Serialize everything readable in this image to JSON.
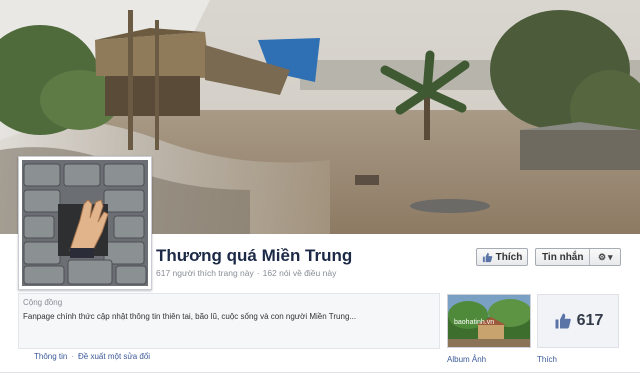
{
  "page": {
    "title": "Thương quá Miền Trung",
    "likes_text": "617 người thích trang này",
    "talking_text": "162 nói về điều này"
  },
  "actions": {
    "like_label": "Thích",
    "message_label": "Tin nhắn"
  },
  "about": {
    "category": "Cộng đồng",
    "description": "Fanpage chính thức cập nhật thông tin thiên tai, bão lũ, cuộc sống và con người Miền Trung..."
  },
  "links": {
    "info": "Thông tin",
    "suggest_edit": "Đề xuất một sửa đổi"
  },
  "apps": {
    "album_label": "Album Ảnh",
    "album_watermark": "baohatinh.vn",
    "likes_count": "617",
    "likes_label": "Thích"
  },
  "colors": {
    "link": "#3b5998",
    "title": "#1c2a47",
    "flood_water": "#9c8b76"
  }
}
